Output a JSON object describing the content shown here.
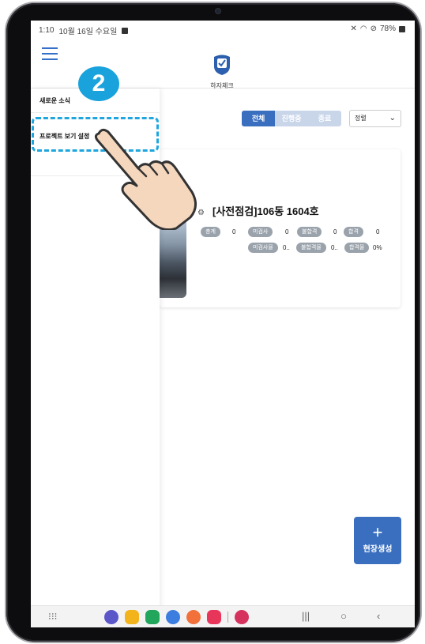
{
  "status_bar": {
    "time": "1:10",
    "date": "10월 16일 수요일",
    "battery": "78%"
  },
  "header": {
    "app_name": "하자체크"
  },
  "drawer": {
    "items": [
      {
        "label": "새로운 소식"
      },
      {
        "label": "프로젝트 보기 설정"
      }
    ]
  },
  "annotation": {
    "step": "2"
  },
  "filter": {
    "tabs": [
      {
        "label": "전체"
      },
      {
        "label": "진행중"
      },
      {
        "label": "종료"
      }
    ],
    "sort_value": "정렬"
  },
  "project_card": {
    "title": "[사전점검]106동 1604호",
    "stats": [
      {
        "label": "총계",
        "value": "0"
      },
      {
        "label": "미검사",
        "value": "0"
      },
      {
        "label": "불합격",
        "value": "0"
      },
      {
        "label": "합격",
        "value": "0"
      },
      {
        "label": "미검사율",
        "value": "0.."
      },
      {
        "label": "불합격율",
        "value": "0.."
      },
      {
        "label": "합격율",
        "value": "0%"
      }
    ]
  },
  "fab": {
    "plus": "+",
    "label": "현장생성"
  },
  "colors": {
    "accent": "#3a6fbf",
    "annotation": "#19a2dc"
  }
}
